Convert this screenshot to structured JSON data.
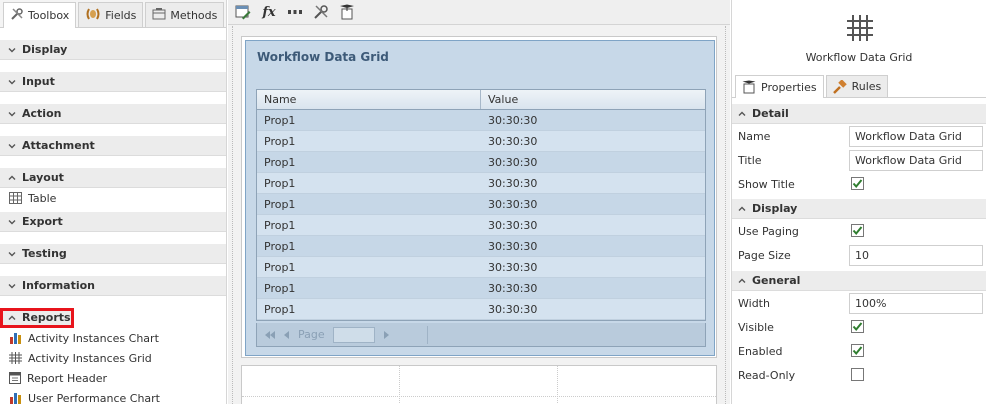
{
  "toolbox": {
    "tabs": [
      {
        "label": "Toolbox",
        "icon": "tools-icon"
      },
      {
        "label": "Fields",
        "icon": "fields-icon"
      },
      {
        "label": "Methods",
        "icon": "methods-icon"
      }
    ],
    "categories": {
      "display": "Display",
      "input": "Input",
      "action": "Action",
      "attachment": "Attachment",
      "layout": "Layout",
      "export": "Export",
      "testing": "Testing",
      "information": "Information",
      "reports": "Reports"
    },
    "layout_items": [
      {
        "label": "Table",
        "icon": "table-icon"
      }
    ],
    "report_items": [
      {
        "label": "Activity Instances Chart",
        "icon": "bar-chart-icon"
      },
      {
        "label": "Activity Instances Grid",
        "icon": "grid-icon"
      },
      {
        "label": "Report Header",
        "icon": "report-header-icon"
      },
      {
        "label": "User Performance Chart",
        "icon": "bar-chart-icon"
      }
    ],
    "highlight_color": "#e8141c"
  },
  "canvas": {
    "toolbar": {
      "expression_label": "fx"
    },
    "grid": {
      "title": "Workflow Data Grid",
      "columns": [
        "Name",
        "Value"
      ],
      "rows": [
        [
          "Prop1",
          "30:30:30"
        ],
        [
          "Prop1",
          "30:30:30"
        ],
        [
          "Prop1",
          "30:30:30"
        ],
        [
          "Prop1",
          "30:30:30"
        ],
        [
          "Prop1",
          "30:30:30"
        ],
        [
          "Prop1",
          "30:30:30"
        ],
        [
          "Prop1",
          "30:30:30"
        ],
        [
          "Prop1",
          "30:30:30"
        ],
        [
          "Prop1",
          "30:30:30"
        ],
        [
          "Prop1",
          "30:30:30"
        ]
      ],
      "pager_label": "Page"
    }
  },
  "properties": {
    "control_title": "Workflow Data Grid",
    "tabs": [
      {
        "label": "Properties",
        "icon": "properties-icon"
      },
      {
        "label": "Rules",
        "icon": "rules-icon"
      }
    ],
    "sections": {
      "detail": "Detail",
      "display": "Display",
      "general": "General"
    },
    "detail": {
      "name_label": "Name",
      "name_value": "Workflow Data Grid",
      "title_label": "Title",
      "title_value": "Workflow Data Grid",
      "show_title_label": "Show Title",
      "show_title": true
    },
    "display": {
      "use_paging_label": "Use Paging",
      "use_paging": true,
      "page_size_label": "Page Size",
      "page_size_value": "10"
    },
    "general": {
      "width_label": "Width",
      "width_value": "100%",
      "visible_label": "Visible",
      "visible": true,
      "enabled_label": "Enabled",
      "enabled": true,
      "readonly_label": "Read-Only",
      "readonly": false
    }
  }
}
